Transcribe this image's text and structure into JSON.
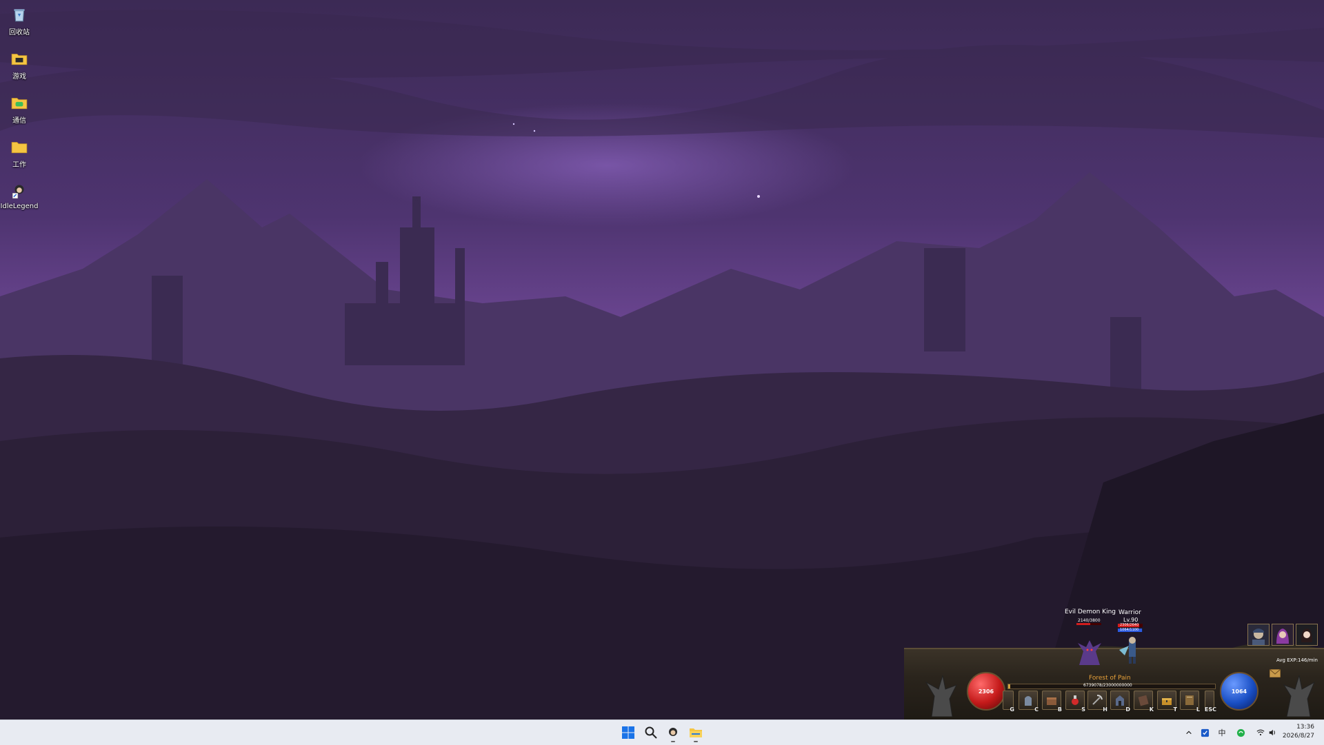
{
  "desktop": {
    "icons": [
      {
        "label": "回收站",
        "icon": "recycle-bin-icon"
      },
      {
        "label": "游戏",
        "icon": "folder-games-icon"
      },
      {
        "label": "通信",
        "icon": "folder-comm-icon"
      },
      {
        "label": "工作",
        "icon": "folder-work-icon"
      },
      {
        "label": "IdleLegend",
        "icon": "idle-legend-app-icon"
      }
    ]
  },
  "game": {
    "enemy": {
      "name": "Evil Demon King",
      "hp": "2140/3800"
    },
    "hero": {
      "class": "Warrior",
      "level": "Lv.90",
      "hp": "2306/2640",
      "mp": "1064/1100"
    },
    "zone": {
      "name": "Forest of Pain",
      "exp": "6739078/23000000000"
    },
    "avg_exp": "Avg EXP:146/min",
    "hp_orb": "2306",
    "mp_orb": "1064",
    "hotkeys": [
      "G",
      "C",
      "B",
      "S",
      "H",
      "D",
      "K",
      "T",
      "L",
      "ESC"
    ],
    "colors": {
      "hp": "#c41a1a",
      "mp": "#1a4fc4",
      "zone_title": "#e8a23a"
    }
  },
  "taskbar": {
    "apps": [
      "windows-start-icon",
      "search-icon",
      "idle-legend-app-icon",
      "file-explorer-icon"
    ],
    "tray": {
      "ime": "中"
    },
    "clock": {
      "time": "13:36",
      "date": "2026/8/27"
    }
  }
}
